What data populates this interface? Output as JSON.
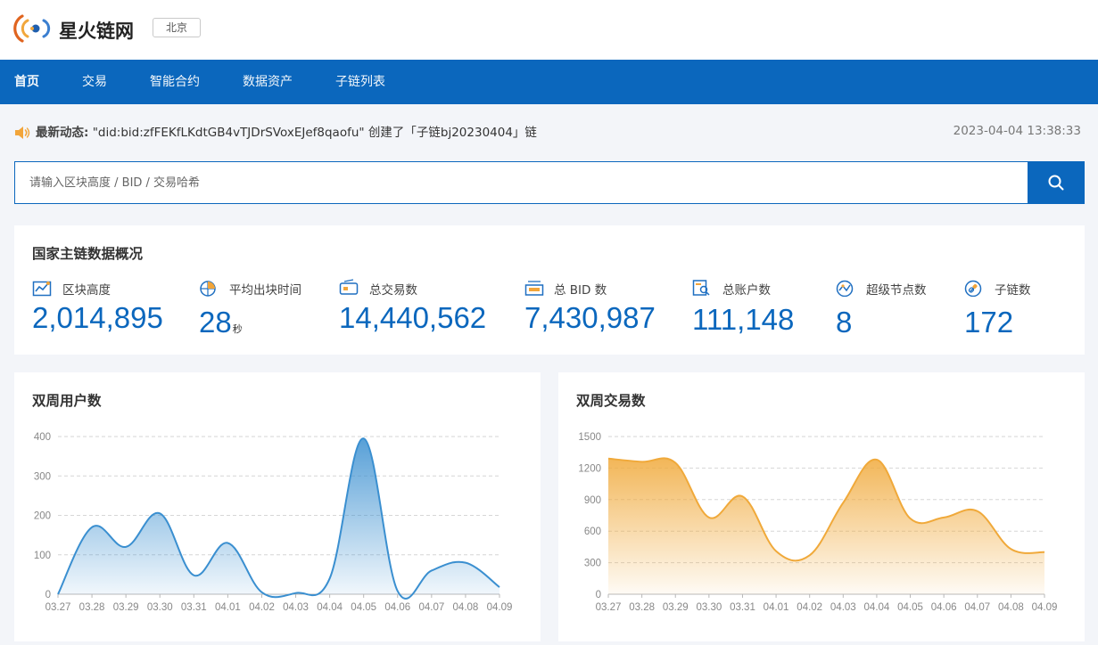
{
  "header": {
    "brand": "星火链网",
    "city": "北京"
  },
  "nav": {
    "items": [
      {
        "label": "首页"
      },
      {
        "label": "交易"
      },
      {
        "label": "智能合约"
      },
      {
        "label": "数据资产"
      },
      {
        "label": "子链列表"
      }
    ]
  },
  "news": {
    "label": "最新动态:",
    "text": "\"did:bid:zfFEKfLKdtGB4vTJDrSVoxEJef8qaofu\" 创建了「子链bj20230404」链",
    "time": "2023-04-04 13:38:33"
  },
  "search": {
    "placeholder": "请输入区块高度 / BID / 交易哈希"
  },
  "overview": {
    "title": "国家主链数据概况",
    "stats": [
      {
        "label": "区块高度",
        "value": "2,014,895",
        "icon": "chart-trend-icon"
      },
      {
        "label": "平均出块时间",
        "value": "28",
        "unit": "秒",
        "icon": "clock-icon"
      },
      {
        "label": "总交易数",
        "value": "14,440,562",
        "icon": "ticket-icon"
      },
      {
        "label": "总 BID 数",
        "value": "7,430,987",
        "icon": "id-card-icon"
      },
      {
        "label": "总账户数",
        "value": "111,148",
        "icon": "account-search-icon"
      },
      {
        "label": "超级节点数",
        "value": "8",
        "icon": "node-icon"
      },
      {
        "label": "子链数",
        "value": "172",
        "icon": "link-icon"
      }
    ]
  },
  "colors": {
    "primary": "#0b67bd",
    "users_line": "#3a8fd0",
    "tx_line": "#f0a93a"
  },
  "chart_data": [
    {
      "type": "area",
      "title": "双周用户数",
      "categories": [
        "03.27",
        "03.28",
        "03.29",
        "03.30",
        "03.31",
        "04.01",
        "04.02",
        "04.03",
        "04.04",
        "04.05",
        "04.06",
        "04.07",
        "04.08",
        "04.09"
      ],
      "values": [
        0,
        170,
        120,
        205,
        48,
        130,
        5,
        3,
        40,
        395,
        8,
        60,
        80,
        18
      ],
      "ylim": [
        0,
        400
      ],
      "yticks": [
        0,
        100,
        200,
        300,
        400
      ],
      "grid": true
    },
    {
      "type": "area",
      "title": "双周交易数",
      "categories": [
        "03.27",
        "03.28",
        "03.29",
        "03.30",
        "03.31",
        "04.01",
        "04.02",
        "04.03",
        "04.04",
        "04.05",
        "04.06",
        "04.07",
        "04.08",
        "04.09"
      ],
      "values": [
        1290,
        1260,
        1250,
        730,
        930,
        410,
        370,
        870,
        1280,
        720,
        730,
        790,
        430,
        400
      ],
      "ylim": [
        0,
        1500
      ],
      "yticks": [
        0,
        300,
        600,
        900,
        1200,
        1500
      ],
      "grid": true
    }
  ]
}
